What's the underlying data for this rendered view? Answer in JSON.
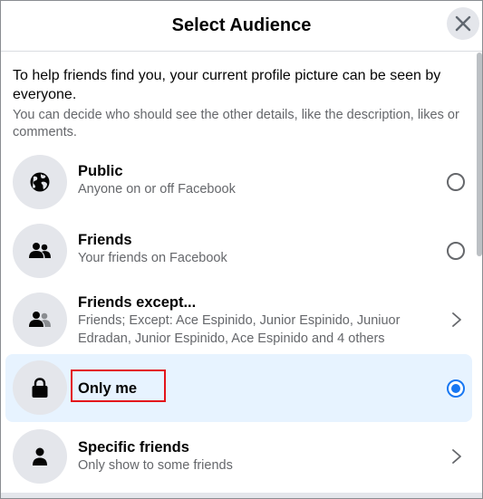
{
  "dialog": {
    "title": "Select Audience",
    "close_icon": "close-icon"
  },
  "intro": {
    "main": "To help friends find you, your current profile picture can be seen by everyone.",
    "sub": "You can decide who should see the other details, like the description, likes or comments."
  },
  "options": [
    {
      "title": "Public",
      "desc": "Anyone on or off Facebook",
      "icon": "globe-icon",
      "control": "radio",
      "selected": false
    },
    {
      "title": "Friends",
      "desc": "Your friends on Facebook",
      "icon": "friends-icon",
      "control": "radio",
      "selected": false
    },
    {
      "title": "Friends except...",
      "desc": "Friends; Except: Ace Espinido, Junior Espinido, Juniuor Edradan, Junior Espinido, Ace Espinido and 4 others",
      "icon": "friends-except-icon",
      "control": "chevron",
      "selected": false
    },
    {
      "title": "Only me",
      "desc": "",
      "icon": "lock-icon",
      "control": "radio",
      "selected": true
    },
    {
      "title": "Specific friends",
      "desc": "Only show to some friends",
      "icon": "person-icon",
      "control": "chevron",
      "selected": false
    }
  ],
  "colors": {
    "accent": "#1877f2",
    "selected_bg": "#e7f3ff",
    "highlight": "#e3141b",
    "secondary_text": "#65676b"
  }
}
